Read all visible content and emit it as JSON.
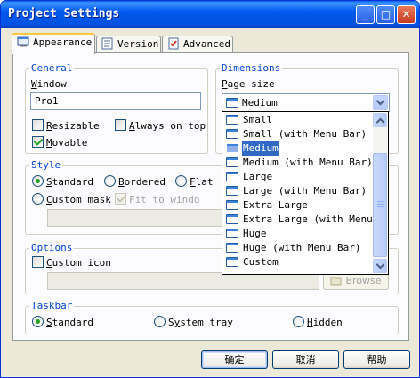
{
  "window": {
    "title": "Project Settings",
    "minimize_glyph": "_",
    "maximize_glyph": "□",
    "close_glyph": "✕"
  },
  "tabs": [
    {
      "label": "Appearance",
      "icon": "appearance-icon",
      "active": true
    },
    {
      "label": "Version",
      "icon": "version-icon",
      "active": false
    },
    {
      "label": "Advanced",
      "icon": "advanced-icon",
      "active": false
    }
  ],
  "general": {
    "legend": "General",
    "window_label_u": "W",
    "window_label_rest": "indow",
    "window_value": "Pro1",
    "resizable_u": "R",
    "resizable_rest": "esizable",
    "resizable_checked": false,
    "always_on_top_u": "A",
    "always_on_top_rest": "lways on top",
    "always_on_top_checked": false,
    "movable_u": "M",
    "movable_rest": "ovable",
    "movable_checked": true
  },
  "dimensions": {
    "legend": "Dimensions",
    "page_size_u": "P",
    "page_size_rest": "age size",
    "page_size_value": "Medium",
    "options": [
      "Small",
      "Small (with Menu Bar)",
      "Medium",
      "Medium (with Menu Bar)",
      "Large",
      "Large (with Menu Bar)",
      "Extra Large",
      "Extra Large (with Menu Bar)",
      "Huge",
      "Huge (with Menu Bar)",
      "Custom"
    ],
    "selected_index": 2
  },
  "style": {
    "legend": "Style",
    "standard_u": "S",
    "standard_rest": "tandard",
    "bordered_u": "B",
    "bordered_rest": "ordered",
    "flat_u": "F",
    "flat_rest": "lat",
    "custom_mask_u": "C",
    "custom_mask_rest": "ustom mask",
    "fit_to_window": "Fit to windo",
    "fit_to_window_checked": true,
    "selected": "Standard",
    "mask_path": ""
  },
  "options": {
    "legend": "Options",
    "custom_icon_u": "C",
    "custom_icon_rest": "ustom icon",
    "custom_icon_checked": false,
    "icon_path": "",
    "browse_label": "Browse"
  },
  "taskbar": {
    "legend": "Taskbar",
    "standard_u": "S",
    "standard_rest": "tandard",
    "system_tray_u": "y",
    "system_tray_pre": "S",
    "system_tray_rest": "stem tray",
    "hidden_u": "H",
    "hidden_rest": "idden",
    "selected": "Standard"
  },
  "buttons": {
    "ok": "确定",
    "cancel": "取消",
    "help": "帮助"
  },
  "colors": {
    "title_bar": "#0058ee",
    "legend_text": "#0046d5",
    "selection": "#316ac5",
    "dialog_bg": "#ece9d8"
  }
}
